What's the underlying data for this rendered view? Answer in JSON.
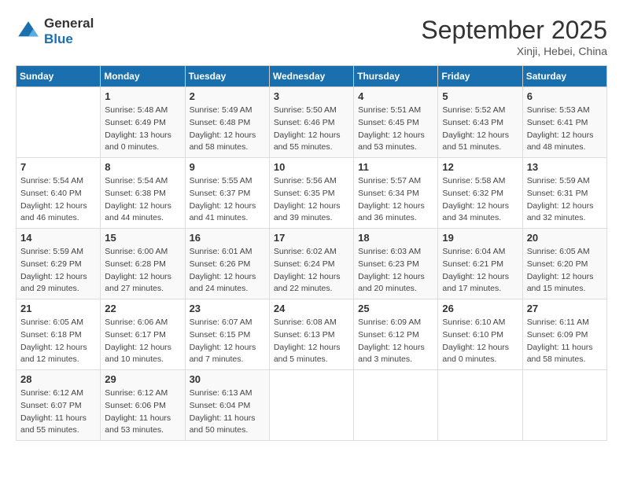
{
  "logo": {
    "line1": "General",
    "line2": "Blue"
  },
  "title": "September 2025",
  "subtitle": "Xinji, Hebei, China",
  "days_of_week": [
    "Sunday",
    "Monday",
    "Tuesday",
    "Wednesday",
    "Thursday",
    "Friday",
    "Saturday"
  ],
  "weeks": [
    [
      {
        "day": "",
        "sunrise": "",
        "sunset": "",
        "daylight": ""
      },
      {
        "day": "1",
        "sunrise": "Sunrise: 5:48 AM",
        "sunset": "Sunset: 6:49 PM",
        "daylight": "Daylight: 13 hours and 0 minutes."
      },
      {
        "day": "2",
        "sunrise": "Sunrise: 5:49 AM",
        "sunset": "Sunset: 6:48 PM",
        "daylight": "Daylight: 12 hours and 58 minutes."
      },
      {
        "day": "3",
        "sunrise": "Sunrise: 5:50 AM",
        "sunset": "Sunset: 6:46 PM",
        "daylight": "Daylight: 12 hours and 55 minutes."
      },
      {
        "day": "4",
        "sunrise": "Sunrise: 5:51 AM",
        "sunset": "Sunset: 6:45 PM",
        "daylight": "Daylight: 12 hours and 53 minutes."
      },
      {
        "day": "5",
        "sunrise": "Sunrise: 5:52 AM",
        "sunset": "Sunset: 6:43 PM",
        "daylight": "Daylight: 12 hours and 51 minutes."
      },
      {
        "day": "6",
        "sunrise": "Sunrise: 5:53 AM",
        "sunset": "Sunset: 6:41 PM",
        "daylight": "Daylight: 12 hours and 48 minutes."
      }
    ],
    [
      {
        "day": "7",
        "sunrise": "Sunrise: 5:54 AM",
        "sunset": "Sunset: 6:40 PM",
        "daylight": "Daylight: 12 hours and 46 minutes."
      },
      {
        "day": "8",
        "sunrise": "Sunrise: 5:54 AM",
        "sunset": "Sunset: 6:38 PM",
        "daylight": "Daylight: 12 hours and 44 minutes."
      },
      {
        "day": "9",
        "sunrise": "Sunrise: 5:55 AM",
        "sunset": "Sunset: 6:37 PM",
        "daylight": "Daylight: 12 hours and 41 minutes."
      },
      {
        "day": "10",
        "sunrise": "Sunrise: 5:56 AM",
        "sunset": "Sunset: 6:35 PM",
        "daylight": "Daylight: 12 hours and 39 minutes."
      },
      {
        "day": "11",
        "sunrise": "Sunrise: 5:57 AM",
        "sunset": "Sunset: 6:34 PM",
        "daylight": "Daylight: 12 hours and 36 minutes."
      },
      {
        "day": "12",
        "sunrise": "Sunrise: 5:58 AM",
        "sunset": "Sunset: 6:32 PM",
        "daylight": "Daylight: 12 hours and 34 minutes."
      },
      {
        "day": "13",
        "sunrise": "Sunrise: 5:59 AM",
        "sunset": "Sunset: 6:31 PM",
        "daylight": "Daylight: 12 hours and 32 minutes."
      }
    ],
    [
      {
        "day": "14",
        "sunrise": "Sunrise: 5:59 AM",
        "sunset": "Sunset: 6:29 PM",
        "daylight": "Daylight: 12 hours and 29 minutes."
      },
      {
        "day": "15",
        "sunrise": "Sunrise: 6:00 AM",
        "sunset": "Sunset: 6:28 PM",
        "daylight": "Daylight: 12 hours and 27 minutes."
      },
      {
        "day": "16",
        "sunrise": "Sunrise: 6:01 AM",
        "sunset": "Sunset: 6:26 PM",
        "daylight": "Daylight: 12 hours and 24 minutes."
      },
      {
        "day": "17",
        "sunrise": "Sunrise: 6:02 AM",
        "sunset": "Sunset: 6:24 PM",
        "daylight": "Daylight: 12 hours and 22 minutes."
      },
      {
        "day": "18",
        "sunrise": "Sunrise: 6:03 AM",
        "sunset": "Sunset: 6:23 PM",
        "daylight": "Daylight: 12 hours and 20 minutes."
      },
      {
        "day": "19",
        "sunrise": "Sunrise: 6:04 AM",
        "sunset": "Sunset: 6:21 PM",
        "daylight": "Daylight: 12 hours and 17 minutes."
      },
      {
        "day": "20",
        "sunrise": "Sunrise: 6:05 AM",
        "sunset": "Sunset: 6:20 PM",
        "daylight": "Daylight: 12 hours and 15 minutes."
      }
    ],
    [
      {
        "day": "21",
        "sunrise": "Sunrise: 6:05 AM",
        "sunset": "Sunset: 6:18 PM",
        "daylight": "Daylight: 12 hours and 12 minutes."
      },
      {
        "day": "22",
        "sunrise": "Sunrise: 6:06 AM",
        "sunset": "Sunset: 6:17 PM",
        "daylight": "Daylight: 12 hours and 10 minutes."
      },
      {
        "day": "23",
        "sunrise": "Sunrise: 6:07 AM",
        "sunset": "Sunset: 6:15 PM",
        "daylight": "Daylight: 12 hours and 7 minutes."
      },
      {
        "day": "24",
        "sunrise": "Sunrise: 6:08 AM",
        "sunset": "Sunset: 6:13 PM",
        "daylight": "Daylight: 12 hours and 5 minutes."
      },
      {
        "day": "25",
        "sunrise": "Sunrise: 6:09 AM",
        "sunset": "Sunset: 6:12 PM",
        "daylight": "Daylight: 12 hours and 3 minutes."
      },
      {
        "day": "26",
        "sunrise": "Sunrise: 6:10 AM",
        "sunset": "Sunset: 6:10 PM",
        "daylight": "Daylight: 12 hours and 0 minutes."
      },
      {
        "day": "27",
        "sunrise": "Sunrise: 6:11 AM",
        "sunset": "Sunset: 6:09 PM",
        "daylight": "Daylight: 11 hours and 58 minutes."
      }
    ],
    [
      {
        "day": "28",
        "sunrise": "Sunrise: 6:12 AM",
        "sunset": "Sunset: 6:07 PM",
        "daylight": "Daylight: 11 hours and 55 minutes."
      },
      {
        "day": "29",
        "sunrise": "Sunrise: 6:12 AM",
        "sunset": "Sunset: 6:06 PM",
        "daylight": "Daylight: 11 hours and 53 minutes."
      },
      {
        "day": "30",
        "sunrise": "Sunrise: 6:13 AM",
        "sunset": "Sunset: 6:04 PM",
        "daylight": "Daylight: 11 hours and 50 minutes."
      },
      {
        "day": "",
        "sunrise": "",
        "sunset": "",
        "daylight": ""
      },
      {
        "day": "",
        "sunrise": "",
        "sunset": "",
        "daylight": ""
      },
      {
        "day": "",
        "sunrise": "",
        "sunset": "",
        "daylight": ""
      },
      {
        "day": "",
        "sunrise": "",
        "sunset": "",
        "daylight": ""
      }
    ]
  ]
}
